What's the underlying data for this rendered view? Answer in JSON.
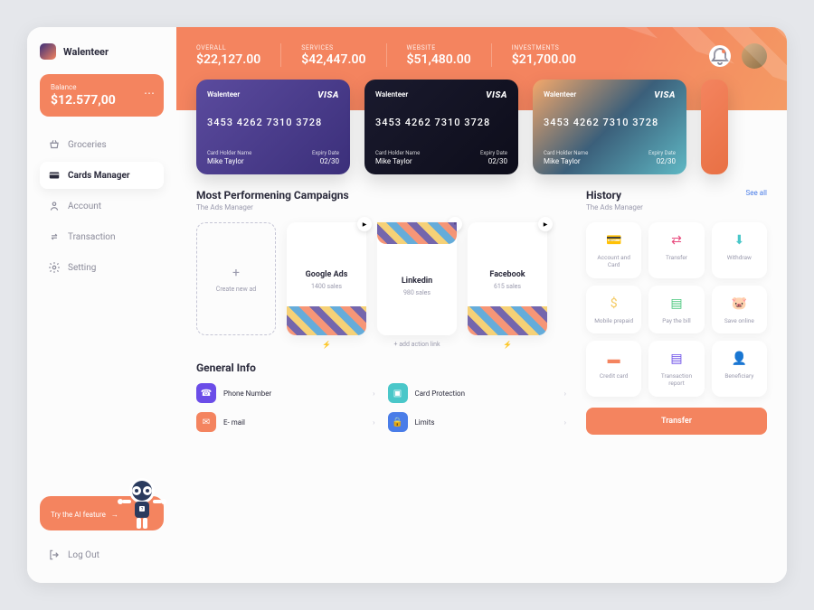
{
  "brand": "Walenteer",
  "balance": {
    "label": "Balance",
    "value": "$12.577,00"
  },
  "nav": {
    "groceries": "Groceries",
    "cards_manager": "Cards Manager",
    "account": "Account",
    "transaction": "Transaction",
    "setting": "Setting"
  },
  "ai": {
    "text": "Try the AI feature",
    "arrow": "→"
  },
  "logout": "Log Out",
  "stats": [
    {
      "label": "OVERALL",
      "value": "$22,127.00"
    },
    {
      "label": "SERVICES",
      "value": "$42,447.00"
    },
    {
      "label": "WEBSITE",
      "value": "$51,480.00"
    },
    {
      "label": "INVESTMENTS",
      "value": "$21,700.00"
    }
  ],
  "cards": [
    {
      "brand": "Walenteer",
      "network": "VISA",
      "number": "3453 4262 7310 3728",
      "holder_label": "Card Holder Name",
      "holder": "Mike Taylor",
      "expiry_label": "Expiry Date",
      "expiry": "02/30"
    },
    {
      "brand": "Walenteer",
      "network": "VISA",
      "number": "3453 4262 7310 3728",
      "holder_label": "Card Holder Name",
      "holder": "Mike Taylor",
      "expiry_label": "Expiry Date",
      "expiry": "02/30"
    },
    {
      "brand": "Walenteer",
      "network": "VISA",
      "number": "3453 4262 7310 3728",
      "holder_label": "Card Holder Name",
      "holder": "Mike Taylor",
      "expiry_label": "Expiry Date",
      "expiry": "02/30"
    }
  ],
  "campaigns": {
    "title": "Most Performening Campaigns",
    "subtitle": "The Ads Manager",
    "add_label": "Create new ad",
    "items": [
      {
        "name": "Google Ads",
        "sales": "1400 sales",
        "btn": "▶"
      },
      {
        "name": "Linkedin",
        "sales": "980 sales",
        "btn": "⏸"
      },
      {
        "name": "Facebook",
        "sales": "615 sales",
        "btn": "▶"
      }
    ],
    "action_link": "+ add action link",
    "bolt": "⚡"
  },
  "general": {
    "title": "General Info",
    "items": [
      {
        "label": "Phone Number",
        "color": "#6b4de8"
      },
      {
        "label": "Card Protection",
        "color": "#4ac7c9"
      },
      {
        "label": "E- mail",
        "color": "#f4845f"
      },
      {
        "label": "Limits",
        "color": "#4a7de8"
      }
    ]
  },
  "history": {
    "title": "History",
    "subtitle": "The Ads Manager",
    "see_all": "See all",
    "tiles": [
      {
        "label": "Account and Card",
        "icon": "💳",
        "color": "#4a7de8"
      },
      {
        "label": "Transfer",
        "icon": "⇄",
        "color": "#e84a7d"
      },
      {
        "label": "Withdraw",
        "icon": "⬇",
        "color": "#4ac7c9"
      },
      {
        "label": "Mobile prepaid",
        "icon": "$",
        "color": "#f4c95f"
      },
      {
        "label": "Pay the bill",
        "icon": "▤",
        "color": "#4ac77d"
      },
      {
        "label": "Save online",
        "icon": "🐷",
        "color": "#f4845f"
      },
      {
        "label": "Credit card",
        "icon": "▬",
        "color": "#f4845f"
      },
      {
        "label": "Transaction report",
        "icon": "▤",
        "color": "#6b4de8"
      },
      {
        "label": "Beneficiary",
        "icon": "👤",
        "color": "#e84a7d"
      }
    ],
    "transfer_btn": "Transfer"
  }
}
